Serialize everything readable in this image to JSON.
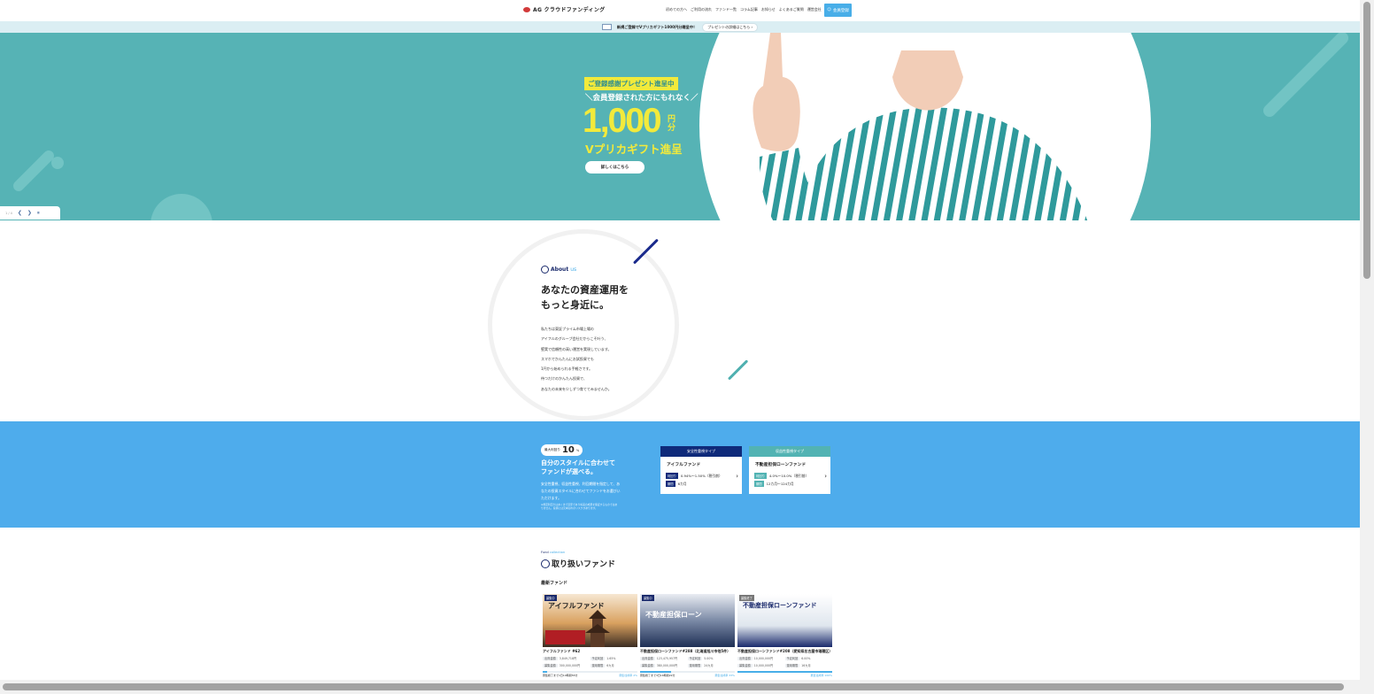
{
  "header": {
    "logo_text": "AG クラウドファンディング",
    "nav": [
      "初めての方へ",
      "ご利用の流れ",
      "ファンド一覧",
      "コラム記事",
      "お知らせ",
      "よくあるご質問",
      "運営会社",
      "ログイン"
    ],
    "signup_label": "会員登録"
  },
  "promo_bar": {
    "text": "新規ご登録でVプリカギフト1000円分贈呈中！",
    "link_label": "プレゼントの詳細はこちら ›"
  },
  "hero": {
    "badge": "ご登録感謝プレゼント進呈中",
    "sub": "＼会員登録された方にもれなく／",
    "amount": "1,000",
    "unit_1": "円",
    "unit_2": "分",
    "gift": "Vプリカギフト進呈",
    "button": "詳しくはこちら"
  },
  "slider": {
    "counter": "1 / 4"
  },
  "about": {
    "label": "About",
    "label_accent": "us",
    "title_line1": "あなたの資産運用を",
    "title_line2": "もっと身近に。",
    "body": [
      "私たちは東証プライム市場上場の",
      "アイフルのグループ会社だからこそ叶う、",
      "堅実で信頼性の高い運営を実現しています。",
      "スマホでかんたんにお試投資でも",
      "1円から始められる手軽さです。",
      "待つだけのかんたん投資で、",
      "あなたの未来を少しずつ育ててみませんか。"
    ]
  },
  "features": {
    "badge_prefix": "最大利回り",
    "badge_number": "10",
    "badge_suffix": "%",
    "title_line1": "自分のスタイルに合わせて",
    "title_line2": "ファンドが選べる。",
    "text": "安全性重視、収益性重視、利回期間を指定して、あなたの投資スタイルに合わせてファンドをお選びいただけます。",
    "note": "※想定利回りはあくまで目安であり将来の成果を保証するものではありません。投資には元本割れのリスクがあります。",
    "cards": [
      {
        "type": "安全性重視タイプ",
        "name": "アイフルファンド",
        "rate_label": "利回り",
        "rate": "0.94%〜1.50%（税引前）",
        "term_label": "期間",
        "term": "6カ月",
        "color": "#0f2a7a"
      },
      {
        "type": "収益性重視タイプ",
        "name": "不動産担保ローンファンド",
        "rate_label": "利回り",
        "rate": "4.0%〜10.0%（税引前）",
        "term_label": "期間",
        "term": "12カ月〜124カ月",
        "color": "#52b3b3"
      }
    ]
  },
  "funds": {
    "eyebrow": "Fund",
    "eyebrow_accent": "collection",
    "title": "取り扱いファンド",
    "latest": "最新ファンド",
    "items": [
      {
        "tag": "募集中",
        "img_text": "アイフルファンド",
        "name": "アイフルファンド #62",
        "s1k": "出資金額",
        "s1v": "3,849,718円",
        "s2k": "予定利回",
        "s2v": "1.65%",
        "s3k": "募集金額",
        "s3v": "300,000,000円",
        "s4k": "運用期間",
        "s4v": "6カ月",
        "progress": 0.05,
        "status": "募集終了まで1日19時間55分",
        "rate": "募集達成率 2%",
        "bg": "#3b2c22"
      },
      {
        "tag": "募集中",
        "img_text": "不動産担保ローン",
        "name": "不動産担保ローンファンド#288（北海道旭川市他5件）",
        "s1k": "出資金額",
        "s1v": "123,475,957円",
        "s2k": "予定利回",
        "s2v": "5.00%",
        "s3k": "募集金額",
        "s3v": "380,000,000円",
        "s4k": "運用期間",
        "s4v": "24カ月",
        "progress": 0.33,
        "status": "募集終了まで3日16時間22分",
        "rate": "募集達成率 33%",
        "bg": "#1e2f55"
      },
      {
        "tag": "募集終了",
        "img_text": "不動産担保ローンファンド",
        "name": "不動産担保ローンファンド#208（愛知県名古屋市瑞穂区）",
        "s1k": "出資金額",
        "s1v": "10,000,000円",
        "s2k": "予定利回",
        "s2v": "6.00%",
        "s3k": "募集金額",
        "s3v": "10,000,000円",
        "s4k": "運用期間",
        "s4v": "16カ月",
        "progress": 1.0,
        "status": "",
        "rate": "募集達成率 100%",
        "bg": "#dfe6ee"
      }
    ]
  },
  "colors": {
    "hero_bg": "#56b3b5",
    "accent_yellow": "#f2ea3b",
    "brand_blue": "#48aee8",
    "navy": "#1a2a6c"
  }
}
